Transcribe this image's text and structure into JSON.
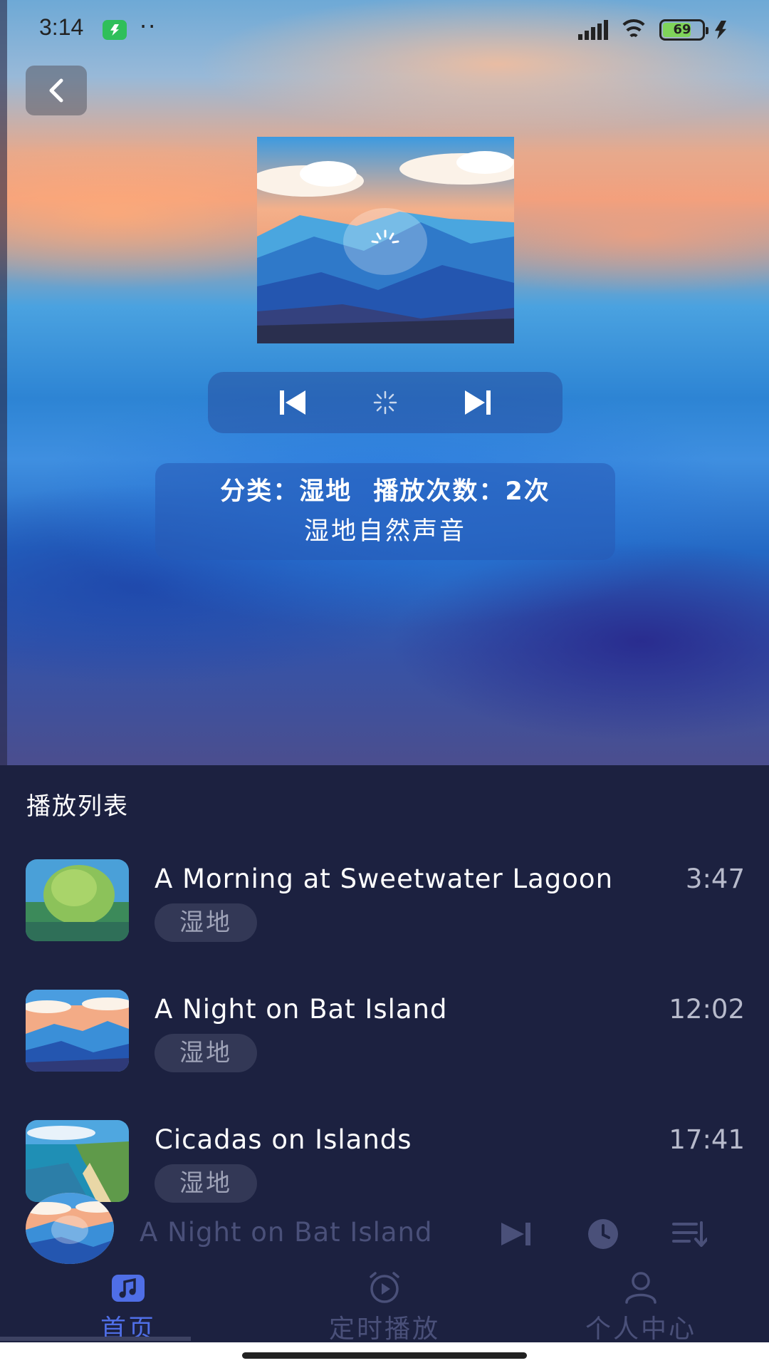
{
  "status_bar": {
    "time": "3:14",
    "dots": "··",
    "battery_level": "69"
  },
  "player": {
    "category_label": "分类：湿地",
    "play_count_label": "播放次数：2次",
    "description": "湿地自然声音"
  },
  "playlist": {
    "title": "播放列表",
    "tracks": [
      {
        "title": "A Morning at Sweetwater Lagoon",
        "tag": "湿地",
        "duration": "3:47"
      },
      {
        "title": "A Night on Bat Island",
        "tag": "湿地",
        "duration": "12:02"
      },
      {
        "title": "Cicadas on Islands",
        "tag": "湿地",
        "duration": "17:41"
      }
    ]
  },
  "mini_player": {
    "now_playing": "A Night on Bat Island"
  },
  "bottom_nav": {
    "items": [
      {
        "label": "首页",
        "icon": "music-note-icon",
        "active": true
      },
      {
        "label": "定时播放",
        "icon": "alarm-clock-icon",
        "active": false
      },
      {
        "label": "个人中心",
        "icon": "person-icon",
        "active": false
      }
    ]
  },
  "colors": {
    "playlist_bg": "#1c2140",
    "active_nav": "#4f6ee6",
    "inactive_nav": "#4a5079",
    "tag_bg": "#333856"
  }
}
